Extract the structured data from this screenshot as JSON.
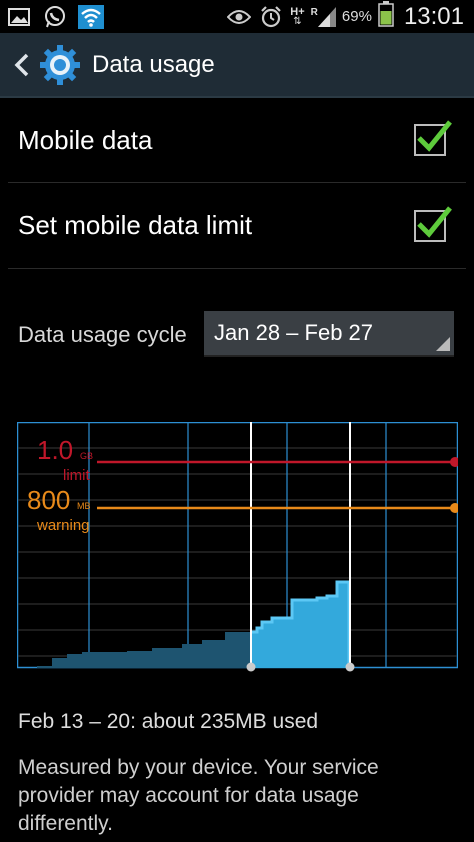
{
  "status_bar": {
    "icons": [
      "photo-icon",
      "whatsapp-icon",
      "wifi-icon",
      "eye-icon",
      "alarm-icon",
      "hplus-icon",
      "roaming-signal-icon",
      "battery-icon"
    ],
    "net_type": "H+",
    "roaming": "R",
    "battery": "69%",
    "time": "13:01"
  },
  "action_bar": {
    "title": "Data usage"
  },
  "settings": {
    "mobile_data": {
      "label": "Mobile data",
      "checked": true
    },
    "data_limit": {
      "label": "Set mobile data limit",
      "checked": true
    }
  },
  "cycle": {
    "label": "Data usage cycle",
    "value": "Jan 28 – Feb 27"
  },
  "chart_data": {
    "type": "area",
    "limit": {
      "value": "1.0",
      "unit": "GB",
      "label": "limit",
      "gb": 1.0,
      "color": "#c0172a"
    },
    "warning": {
      "value": "800",
      "unit": "MB",
      "label": "warning",
      "gb": 0.8,
      "color": "#e88a1a"
    },
    "selection": {
      "start": "Feb 13",
      "end": "Feb 20"
    },
    "accent": "#33b5e5"
  },
  "summary": "Feb 13 – 20: about 235MB used",
  "note": "Measured by your device. Your service provider may account for data usage differently."
}
